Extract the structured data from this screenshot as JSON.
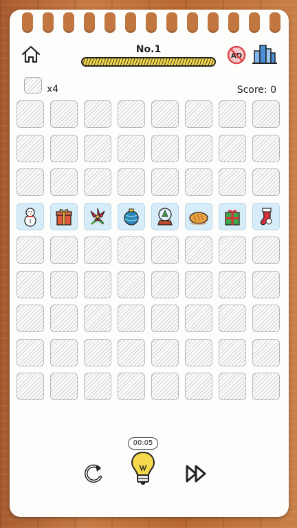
{
  "header": {
    "level_title": "No.1",
    "progress": 1.0
  },
  "stats": {
    "stock_count": "x4",
    "score": "Score: 0"
  },
  "board": {
    "rows": 9,
    "cols": 8,
    "revealed_row": 3,
    "revealed_items": [
      {
        "name": "snowman-icon"
      },
      {
        "name": "gift-box-icon"
      },
      {
        "name": "poinsettia-icon"
      },
      {
        "name": "ornament-ball-icon"
      },
      {
        "name": "snow-globe-icon"
      },
      {
        "name": "bread-loaf-icon"
      },
      {
        "name": "green-gift-icon"
      },
      {
        "name": "christmas-stocking-icon"
      }
    ]
  },
  "footer": {
    "timer": "00:05"
  },
  "colors": {
    "wood": "#b86a37",
    "paper": "#fdfdfb",
    "progress_fill": "#f5d84a",
    "revealed_tile": "#d6ecf8",
    "no_ads_red": "#e0474c",
    "city_blue": "#4a8fd8"
  }
}
